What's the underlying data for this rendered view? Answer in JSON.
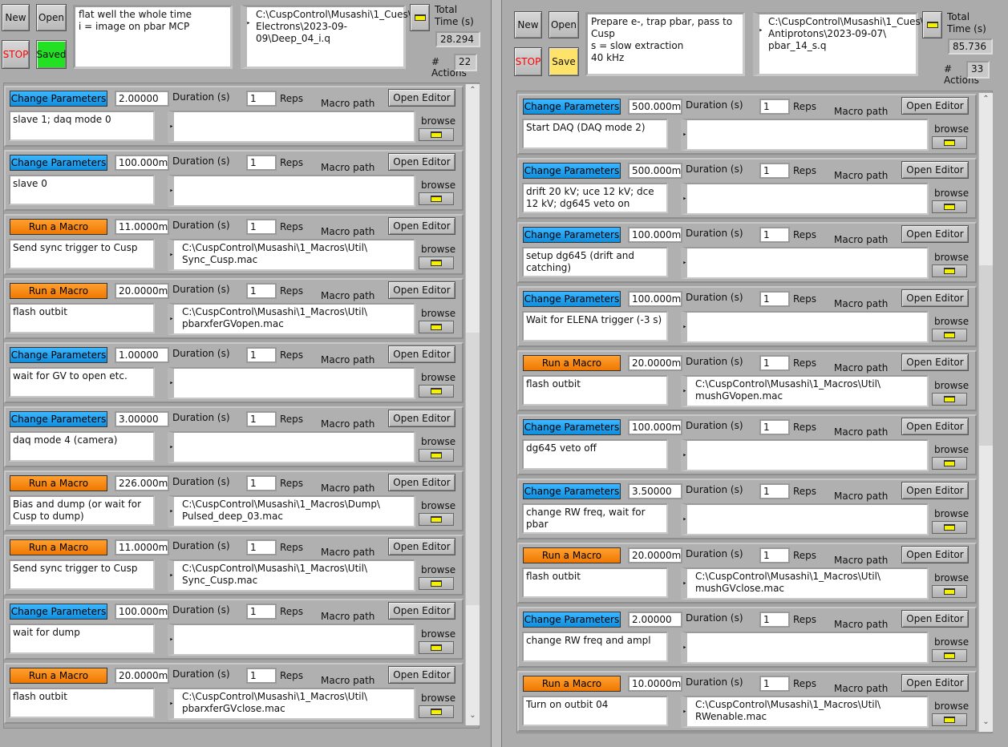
{
  "common": {
    "new": "New",
    "open": "Open",
    "stop": "STOP",
    "total_time": "Total\nTime (s)",
    "actions_label": "# Actions",
    "duration_label": "Duration (s)",
    "reps_label": "Reps",
    "macro_path_label": "Macro path",
    "open_editor": "Open Editor",
    "browse": "browse"
  },
  "left": {
    "save_state": "Saved",
    "save_color": "#22e022",
    "comment": "flat well the whole time\ni = image on pbar MCP",
    "path": "C:\\CuspControl\\Musashi\\1_Cues\\\nElectrons\\2023-09-09\\Deep_04_i.q",
    "total_time": "28.294",
    "actions": "22",
    "rows": [
      {
        "type": "Change Parameters",
        "duration": "2.00000",
        "reps": "1",
        "comment": "slave 1; daq mode 0",
        "macro": ""
      },
      {
        "type": "Change Parameters",
        "duration": "100.000m",
        "reps": "1",
        "comment": "slave 0",
        "macro": ""
      },
      {
        "type": "Run a Macro",
        "duration": "11.0000m",
        "reps": "1",
        "comment": "Send sync trigger to Cusp",
        "macro": "C:\\CuspControl\\Musashi\\1_Macros\\Util\\\nSync_Cusp.mac"
      },
      {
        "type": "Run a Macro",
        "duration": "20.0000m",
        "reps": "1",
        "comment": "flash outbit",
        "macro": "C:\\CuspControl\\Musashi\\1_Macros\\Util\\\npbarxferGVopen.mac"
      },
      {
        "type": "Change Parameters",
        "duration": "1.00000",
        "reps": "1",
        "comment": "wait for GV to open etc.",
        "macro": ""
      },
      {
        "type": "Change Parameters",
        "duration": "3.00000",
        "reps": "1",
        "comment": "daq mode 4 (camera)",
        "macro": ""
      },
      {
        "type": "Run a Macro",
        "duration": "226.000m",
        "reps": "1",
        "comment": "Bias and dump (or wait for Cusp to dump)",
        "macro": "C:\\CuspControl\\Musashi\\1_Macros\\Dump\\\nPulsed_deep_03.mac"
      },
      {
        "type": "Run a Macro",
        "duration": "11.0000m",
        "reps": "1",
        "comment": "Send sync trigger to Cusp",
        "macro": "C:\\CuspControl\\Musashi\\1_Macros\\Util\\\nSync_Cusp.mac"
      },
      {
        "type": "Change Parameters",
        "duration": "100.000m",
        "reps": "1",
        "comment": "wait for dump",
        "macro": ""
      },
      {
        "type": "Run a Macro",
        "duration": "20.0000m",
        "reps": "1",
        "comment": "flash outbit",
        "macro": "C:\\CuspControl\\Musashi\\1_Macros\\Util\\\npbarxferGVclose.mac"
      }
    ]
  },
  "right": {
    "save_state": "Save",
    "save_color": "#fde36a",
    "comment": "Prepare e-, trap pbar, pass to Cusp\ns = slow extraction\n40 kHz",
    "path": "C:\\CuspControl\\Musashi\\1_Cues\\\nAntiprotons\\2023-09-07\\\npbar_14_s.q",
    "total_time": "85.736",
    "actions": "33",
    "rows": [
      {
        "type": "Change Parameters",
        "duration": "500.000m",
        "reps": "1",
        "comment": "Start DAQ (DAQ mode 2)",
        "macro": ""
      },
      {
        "type": "Change Parameters",
        "duration": "500.000m",
        "reps": "1",
        "comment": "drift 20 kV; uce 12 kV; dce 12 kV; dg645 veto on",
        "macro": ""
      },
      {
        "type": "Change Parameters",
        "duration": "100.000m",
        "reps": "1",
        "comment": "setup dg645 (drift and catching)",
        "macro": ""
      },
      {
        "type": "Change Parameters",
        "duration": "100.000m",
        "reps": "1",
        "comment": "Wait for ELENA trigger (-3 s)",
        "macro": ""
      },
      {
        "type": "Run a Macro",
        "duration": "20.0000m",
        "reps": "1",
        "comment": "flash outbit",
        "macro": "C:\\CuspControl\\Musashi\\1_Macros\\Util\\\nmushGVopen.mac"
      },
      {
        "type": "Change Parameters",
        "duration": "100.000m",
        "reps": "1",
        "comment": "dg645 veto off",
        "macro": ""
      },
      {
        "type": "Change Parameters",
        "duration": "3.50000",
        "reps": "1",
        "comment": "change RW freq, wait for pbar",
        "macro": ""
      },
      {
        "type": "Run a Macro",
        "duration": "20.0000m",
        "reps": "1",
        "comment": "flash outbit",
        "macro": "C:\\CuspControl\\Musashi\\1_Macros\\Util\\\nmushGVclose.mac"
      },
      {
        "type": "Change Parameters",
        "duration": "2.00000",
        "reps": "1",
        "comment": "change RW freq and ampl",
        "macro": ""
      },
      {
        "type": "Run a Macro",
        "duration": "10.0000m",
        "reps": "1",
        "comment": "Turn on outbit 04",
        "macro": "C:\\CuspControl\\Musashi\\1_Macros\\Util\\\nRWenable.mac"
      }
    ]
  }
}
